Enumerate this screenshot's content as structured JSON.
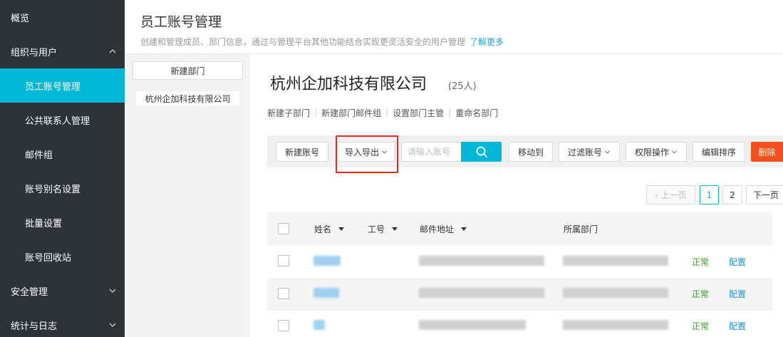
{
  "sidebar": {
    "items": [
      {
        "label": "概览",
        "level": "top"
      },
      {
        "label": "组织与用户",
        "level": "top",
        "expanded": true
      },
      {
        "label": "员工账号管理",
        "level": "sub",
        "active": true
      },
      {
        "label": "公共联系人管理",
        "level": "sub"
      },
      {
        "label": "邮件组",
        "level": "sub"
      },
      {
        "label": "账号别名设置",
        "level": "sub"
      },
      {
        "label": "批量设置",
        "level": "sub"
      },
      {
        "label": "账号回收站",
        "level": "sub"
      },
      {
        "label": "安全管理",
        "level": "top",
        "expanded": false
      },
      {
        "label": "统计与日志",
        "level": "top",
        "expanded": false
      }
    ]
  },
  "header": {
    "title": "员工账号管理",
    "description": "创建和管理成员、部门信息，通过与管理平台其他功能结合实现更灵活安全的用户管理",
    "learn_more": "了解更多"
  },
  "dept_panel": {
    "new_dept_label": "新建部门",
    "tree_root": "杭州企加科技有限公司"
  },
  "company": {
    "name": "杭州企加科技有限公司",
    "count": "(25人)",
    "actions": [
      "新建子部门",
      "新建部门邮件组",
      "设置部门主管",
      "重命名部门"
    ]
  },
  "toolbar": {
    "new_account": "新建账号",
    "import_export": "导入导出",
    "search_placeholder": "请输入账号",
    "move_to": "移动到",
    "filter_accounts": "过滤账号",
    "permission_ops": "权限操作",
    "edit_order": "编辑排序",
    "delete": "删除"
  },
  "pagination": {
    "prev": "上一页",
    "pages": [
      "1",
      "2"
    ],
    "current": "1",
    "next": "下一页"
  },
  "table": {
    "columns": [
      "姓名",
      "工号",
      "邮件地址",
      "所属部门"
    ],
    "rows": [
      {
        "status": "正常",
        "action": "配置"
      },
      {
        "status": "正常",
        "action": "配置"
      },
      {
        "status": "正常",
        "action": "配置"
      }
    ]
  },
  "colors": {
    "sidebar_bg": "#2f3236",
    "accent": "#00b7d6",
    "danger": "#f4511e",
    "highlight": "#e8281e",
    "status_ok": "#2aa515",
    "link": "#1a8fd6"
  }
}
